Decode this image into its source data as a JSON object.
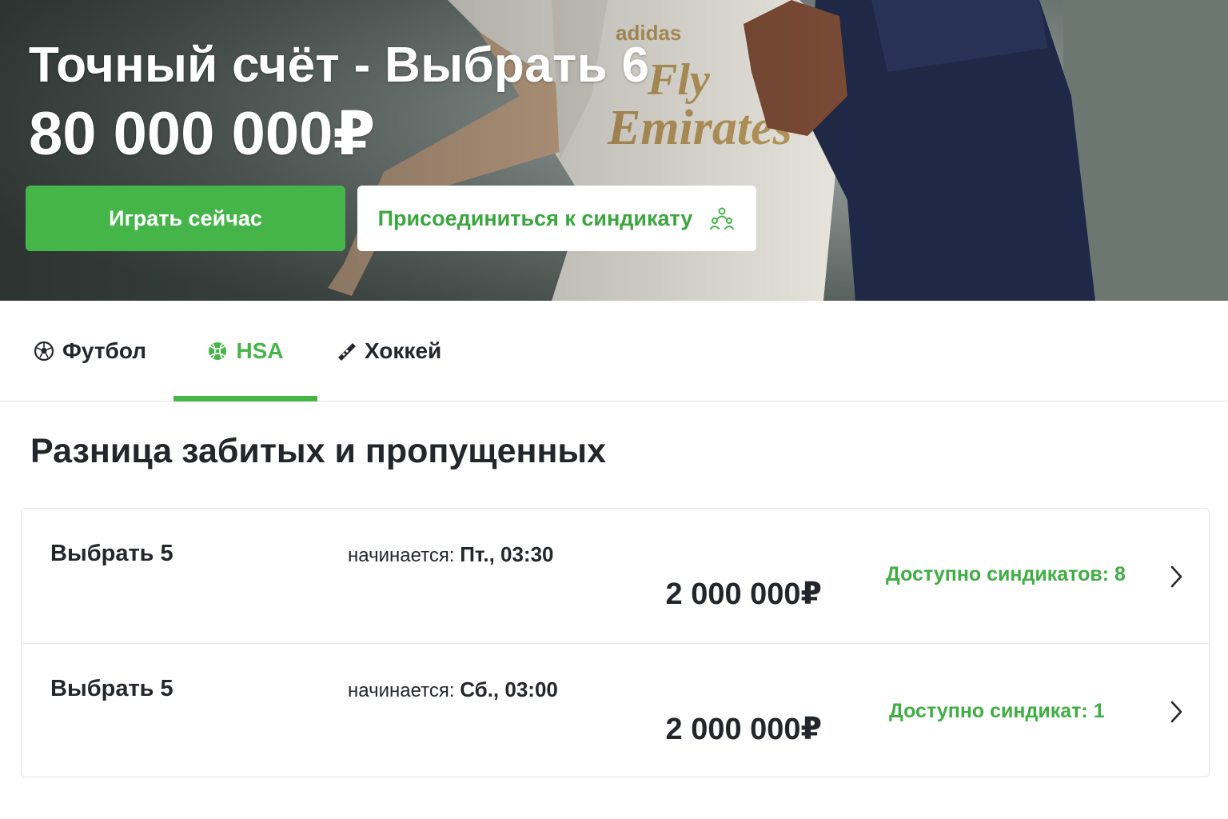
{
  "hero": {
    "title": "Точный счёт - Выбрать 6",
    "amount": "80 000 000₽",
    "play_button": "Играть сейчас",
    "join_button": "Присоединиться к синдикату",
    "join_icon": "group-icon"
  },
  "tabs": [
    {
      "label": "Футбол",
      "icon": "soccer-ball-icon",
      "active": false
    },
    {
      "label": "HSA",
      "icon": "tennis-ball-icon",
      "active": true
    },
    {
      "label": "Хоккей",
      "icon": "hockey-stick-icon",
      "active": false
    }
  ],
  "section": {
    "title": "Разница забитых и пропущенных"
  },
  "rows": [
    {
      "name": "Выбрать 5",
      "start_label": "начинается:",
      "start_value": "Пт., 03:30",
      "prize": "2 000 000₽",
      "syndicates": "Доступно синдикатов: 8"
    },
    {
      "name": "Выбрать 5",
      "start_label": "начинается:",
      "start_value": "Сб., 03:00",
      "prize": "2 000 000₽",
      "syndicates": "Доступно синдикат: 1"
    }
  ],
  "colors": {
    "accent": "#45b549",
    "text": "#23262b",
    "border": "#e2e4e6"
  }
}
